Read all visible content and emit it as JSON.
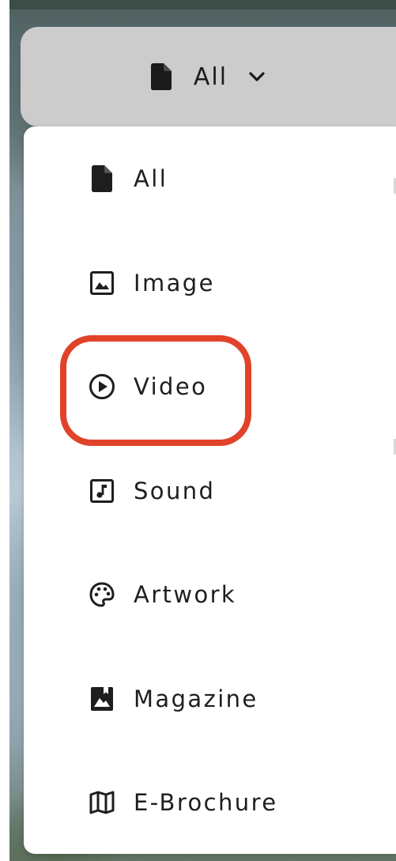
{
  "filter": {
    "selected_label": "All",
    "trigger_icon": "file-icon",
    "chevron_icon": "chevron-down-icon"
  },
  "menu": {
    "items": [
      {
        "label": "All",
        "icon": "file-icon"
      },
      {
        "label": "Image",
        "icon": "image-icon"
      },
      {
        "label": "Video",
        "icon": "play-circle-icon"
      },
      {
        "label": "Sound",
        "icon": "music-note-icon"
      },
      {
        "label": "Artwork",
        "icon": "palette-icon"
      },
      {
        "label": "Magazine",
        "icon": "photo-book-icon"
      },
      {
        "label": "E-Brochure",
        "icon": "map-icon"
      }
    ]
  },
  "highlight": {
    "target": "Video",
    "color": "#e0432a"
  },
  "colors": {
    "trigger_bg": "#cccccc",
    "menu_bg": "#ffffff",
    "text": "#1e1e1e"
  }
}
